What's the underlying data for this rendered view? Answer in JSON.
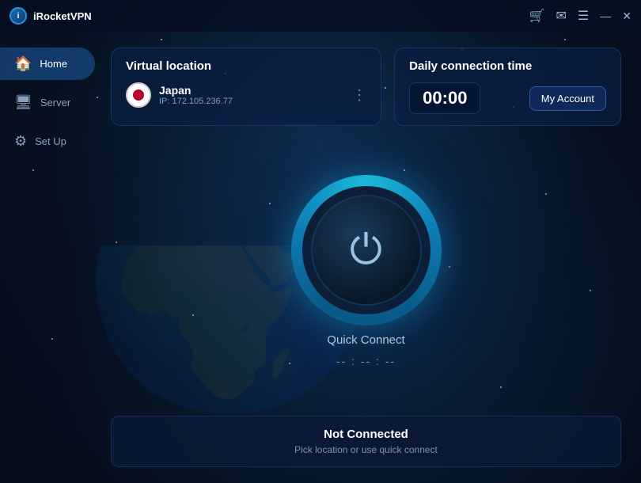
{
  "app": {
    "title": "iRocketVPN",
    "logo_letter": "i"
  },
  "titlebar": {
    "cart_icon": "🛒",
    "mail_icon": "✉",
    "menu_icon": "☰",
    "minimize_icon": "—",
    "close_icon": "✕"
  },
  "sidebar": {
    "items": [
      {
        "id": "home",
        "label": "Home",
        "icon": "🏠",
        "active": true
      },
      {
        "id": "server",
        "label": "Server",
        "icon": "⚙",
        "active": false
      },
      {
        "id": "setup",
        "label": "Set Up",
        "icon": "⚙",
        "active": false
      }
    ]
  },
  "location_card": {
    "title": "Virtual location",
    "country": "Japan",
    "ip": "IP: 172.105.236.77",
    "more_icon": "⋮"
  },
  "time_card": {
    "title": "Daily connection time",
    "time": "00:00",
    "button_label": "My Account"
  },
  "power_button": {
    "label": "Quick Connect",
    "timer": "-- : -- : --"
  },
  "status_bar": {
    "title": "Not Connected",
    "subtitle": "Pick location or use quick connect"
  },
  "colors": {
    "accent": "#1ab8d8",
    "accent2": "#0e7db5",
    "bg_dark": "#061020",
    "text_dim": "rgba(160,200,240,0.7)"
  }
}
